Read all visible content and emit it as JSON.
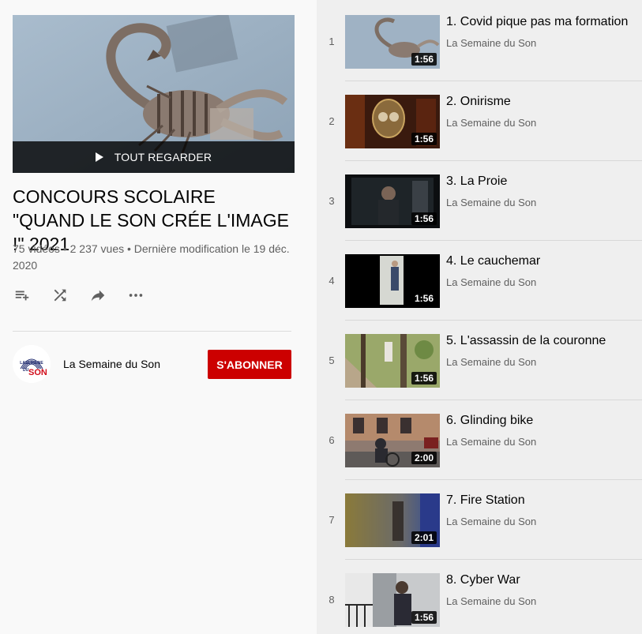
{
  "playlist": {
    "play_all_label": "TOUT REGARDER",
    "title": "CONCOURS SCOLAIRE \"QUAND LE SON CRÉE L'IMAGE !\" 2021",
    "stats": "75 vidéos • 2 237 vues • Dernière modification le 19 déc. 2020"
  },
  "actions": {
    "save_icon": "playlist-add-icon",
    "shuffle_icon": "shuffle-icon",
    "share_icon": "share-icon",
    "more_icon": "more-horiz-icon"
  },
  "owner": {
    "name": "La Semaine du Son",
    "logo_text_top": "LASEMAINE",
    "logo_text_mid": "DU",
    "logo_text_bottom": "SON",
    "subscribe_label": "S'ABONNER"
  },
  "colors": {
    "subscribe": "#cc0000",
    "list_bg": "#efefef",
    "sidebar_bg": "#f9f9f9"
  },
  "videos": [
    {
      "index": "1",
      "title": "1. Covid pique pas ma formation",
      "channel": "La Semaine du Son",
      "duration": "1:56"
    },
    {
      "index": "2",
      "title": "2. Onirisme",
      "channel": "La Semaine du Son",
      "duration": "1:56"
    },
    {
      "index": "3",
      "title": "3. La Proie",
      "channel": "La Semaine du Son",
      "duration": "1:56"
    },
    {
      "index": "4",
      "title": "4. Le cauchemar",
      "channel": "La Semaine du Son",
      "duration": "1:56"
    },
    {
      "index": "5",
      "title": "5. L'assassin de la couronne",
      "channel": "La Semaine du Son",
      "duration": "1:56"
    },
    {
      "index": "6",
      "title": "6. Glinding bike",
      "channel": "La Semaine du Son",
      "duration": "2:00"
    },
    {
      "index": "7",
      "title": "7. Fire Station",
      "channel": "La Semaine du Son",
      "duration": "2:01"
    },
    {
      "index": "8",
      "title": "8. Cyber War",
      "channel": "La Semaine du Son",
      "duration": "1:56"
    }
  ]
}
